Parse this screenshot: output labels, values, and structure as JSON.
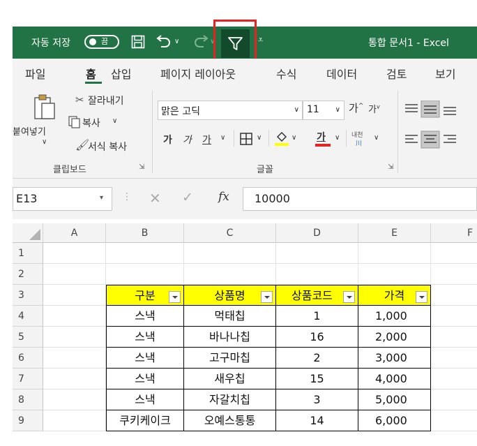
{
  "titlebar": {
    "autosave_label": "자동 저장",
    "autosave_state": "끔",
    "doc_title": "통합 문서1  -  Excel"
  },
  "menu": {
    "tabs": [
      "파일",
      "홈",
      "삽입",
      "페이지 레이아웃",
      "수식",
      "데이터",
      "검토",
      "보기"
    ],
    "active": "홈"
  },
  "ribbon": {
    "clipboard": {
      "paste": "붙여넣기",
      "cut": "잘라내기",
      "copy": "복사",
      "format_painter": "서식 복사",
      "group_label": "클립보드"
    },
    "font": {
      "font_name": "맑은 고딕",
      "font_size": "11",
      "bold": "가",
      "italic": "가",
      "underline": "가",
      "font_color_letter": "가",
      "phonetic": "내천",
      "group_label": "글꼴"
    }
  },
  "formula_bar": {
    "name_box": "E13",
    "formula": "10000",
    "fx": "fx"
  },
  "grid": {
    "columns": [
      "A",
      "B",
      "C",
      "D",
      "E",
      "F"
    ],
    "rows": [
      "1",
      "2",
      "3",
      "4",
      "5",
      "6",
      "7",
      "8",
      "9"
    ],
    "table_headers": [
      "구분",
      "상품명",
      "상품코드",
      "가격"
    ],
    "table_rows": [
      [
        "스낵",
        "먹태칩",
        "1",
        "1,000"
      ],
      [
        "스낵",
        "바나나칩",
        "16",
        "2,000"
      ],
      [
        "스낵",
        "고구마칩",
        "2",
        "3,000"
      ],
      [
        "스낵",
        "새우칩",
        "15",
        "4,000"
      ],
      [
        "스낵",
        "자갈치칩",
        "3",
        "5,000"
      ],
      [
        "쿠키케이크",
        "오예스통통",
        "14",
        "6,000"
      ]
    ]
  },
  "colors": {
    "excel_green": "#217346",
    "highlight_red": "#e8231f",
    "header_yellow": "#ffff00"
  }
}
